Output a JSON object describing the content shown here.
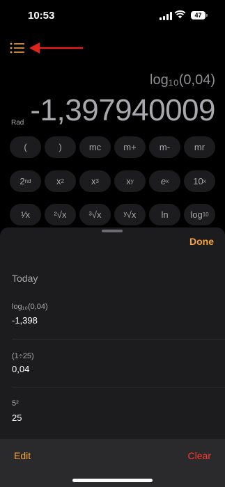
{
  "status_bar": {
    "time": "10:53",
    "battery": "47"
  },
  "calculator": {
    "expression": "log₁₀(0,04)",
    "result": "-1,397940009",
    "mode": "Rad",
    "row1": [
      "(",
      ")",
      "mc",
      "m+",
      "m-",
      "mr"
    ],
    "row2": [
      {
        "base": "2",
        "sup": "nd"
      },
      {
        "base": "x",
        "sup": "2"
      },
      {
        "base": "x",
        "sup": "3"
      },
      {
        "base": "x",
        "sup": "y"
      },
      {
        "base": "e",
        "sup": "x"
      },
      {
        "base": "10",
        "sup": "x"
      }
    ],
    "row3": [
      {
        "label": "¹⁄x"
      },
      {
        "label": "²√x"
      },
      {
        "label": "³√x"
      },
      {
        "label": "ʸ√x"
      },
      {
        "label": "ln"
      },
      {
        "base": "log",
        "sub": "10"
      }
    ]
  },
  "history": {
    "done_label": "Done",
    "section": "Today",
    "entries": [
      {
        "expression": "log₁₀(0,04)",
        "value": "-1,398"
      },
      {
        "expression": "(1÷25)",
        "value": "0,04"
      },
      {
        "expression": "5²",
        "value": "25"
      }
    ],
    "edit_label": "Edit",
    "clear_label": "Clear"
  },
  "colors": {
    "accent": "#f6a33b",
    "destructive": "#ff3b30",
    "annotation_arrow": "#e0231b"
  }
}
